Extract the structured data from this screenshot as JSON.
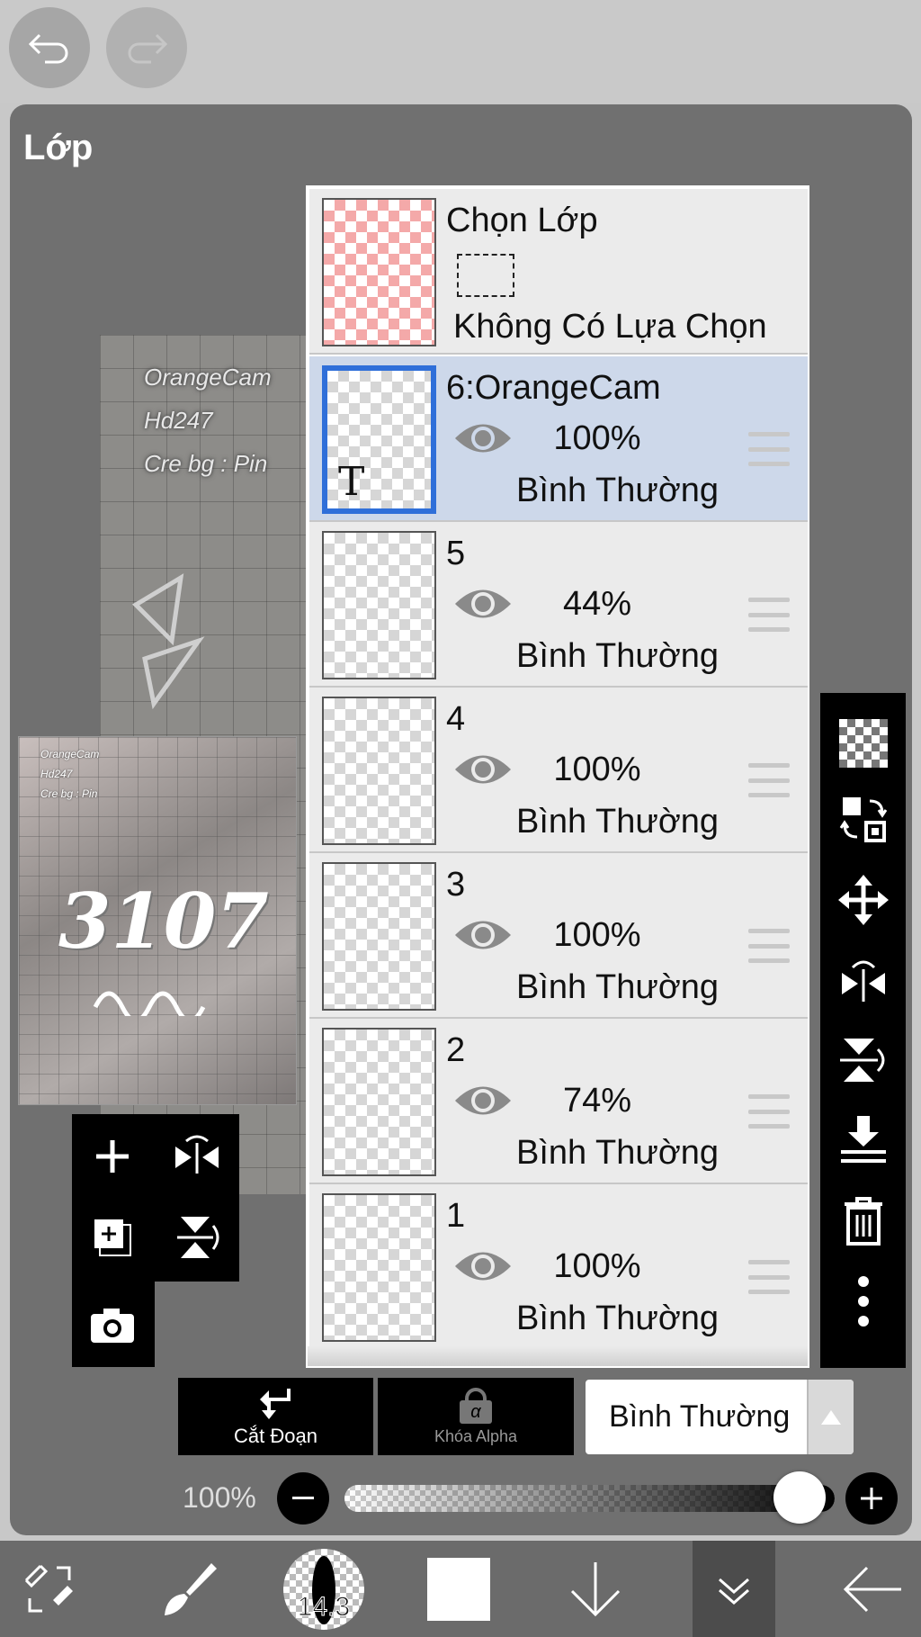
{
  "panel": {
    "title": "Lớp"
  },
  "canvas_preview": {
    "watermark_lines": [
      "OrangeCam",
      "Hd247",
      "Cre bg : Pin"
    ],
    "big_text": "3107"
  },
  "selection_layer": {
    "title": "Chọn Lớp",
    "status": "Không Có Lựa Chọn"
  },
  "layers": [
    {
      "name": "6:OrangeCam",
      "opacity": "100%",
      "blend": "Bình Thường",
      "selected": true,
      "thumb_glyph": "T"
    },
    {
      "name": "5",
      "opacity": "44%",
      "blend": "Bình Thường",
      "selected": false
    },
    {
      "name": "4",
      "opacity": "100%",
      "blend": "Bình Thường",
      "selected": false
    },
    {
      "name": "3",
      "opacity": "100%",
      "blend": "Bình Thường",
      "selected": false
    },
    {
      "name": "2",
      "opacity": "74%",
      "blend": "Bình Thường",
      "selected": false
    },
    {
      "name": "1",
      "opacity": "100%",
      "blend": "Bình Thường",
      "selected": false
    }
  ],
  "controls": {
    "clipping_label": "Cắt Đoạn",
    "alpha_lock_label": "Khóa Alpha",
    "alpha_glyph": "α",
    "blend_mode": "Bình Thường",
    "opacity_label": "100%",
    "opacity_value": 1.0
  },
  "bottombar": {
    "brush_size": "14.3",
    "color": "#ffffff"
  },
  "icons": {
    "undo": "undo-icon",
    "redo": "redo-icon",
    "left_tools": [
      "add-layer-icon",
      "flip-horizontal-icon",
      "duplicate-layer-icon",
      "flip-vertical-icon",
      "camera-icon"
    ],
    "right_tools": [
      "transparency-icon",
      "swap-icon",
      "move-icon",
      "rotate-flip-icon",
      "vertical-flip-icon",
      "merge-down-icon",
      "trash-icon",
      "more-icon"
    ]
  }
}
